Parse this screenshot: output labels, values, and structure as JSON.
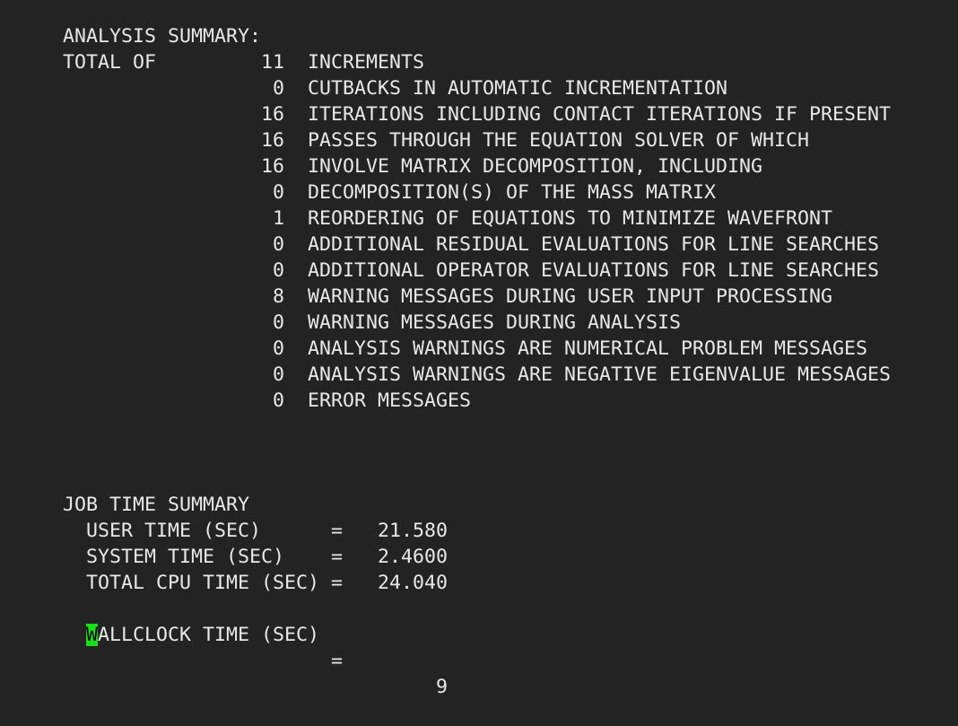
{
  "analysis": {
    "title": "ANALYSIS SUMMARY:",
    "total_of_label": "TOTAL OF",
    "rows": [
      {
        "count": "11",
        "text": "INCREMENTS"
      },
      {
        "count": "0",
        "text": "CUTBACKS IN AUTOMATIC INCREMENTATION"
      },
      {
        "count": "16",
        "text": "ITERATIONS INCLUDING CONTACT ITERATIONS IF PRESENT"
      },
      {
        "count": "16",
        "text": "PASSES THROUGH THE EQUATION SOLVER OF WHICH"
      },
      {
        "count": "16",
        "text": "INVOLVE MATRIX DECOMPOSITION, INCLUDING"
      },
      {
        "count": "0",
        "text": "DECOMPOSITION(S) OF THE MASS MATRIX"
      },
      {
        "count": "1",
        "text": "REORDERING OF EQUATIONS TO MINIMIZE WAVEFRONT"
      },
      {
        "count": "0",
        "text": "ADDITIONAL RESIDUAL EVALUATIONS FOR LINE SEARCHES"
      },
      {
        "count": "0",
        "text": "ADDITIONAL OPERATOR EVALUATIONS FOR LINE SEARCHES"
      },
      {
        "count": "8",
        "text": "WARNING MESSAGES DURING USER INPUT PROCESSING"
      },
      {
        "count": "0",
        "text": "WARNING MESSAGES DURING ANALYSIS"
      },
      {
        "count": "0",
        "text": "ANALYSIS WARNINGS ARE NUMERICAL PROBLEM MESSAGES"
      },
      {
        "count": "0",
        "text": "ANALYSIS WARNINGS ARE NEGATIVE EIGENVALUE MESSAGES"
      },
      {
        "count": "0",
        "text": "ERROR MESSAGES"
      }
    ]
  },
  "job_time": {
    "title": "JOB TIME SUMMARY",
    "equals": "=",
    "rows": [
      {
        "label": "USER TIME (SEC)",
        "value": "21.580"
      },
      {
        "label": "SYSTEM TIME (SEC)",
        "value": "2.4600"
      },
      {
        "label": "TOTAL CPU TIME (SEC)",
        "value": "24.040"
      }
    ],
    "wallclock": {
      "cursor_char": "W",
      "label_rest": "ALLCLOCK TIME (SEC)",
      "value": "9"
    }
  },
  "colors": {
    "background": "#232323",
    "text": "#e8e8e8",
    "cursor": "#16e016"
  }
}
